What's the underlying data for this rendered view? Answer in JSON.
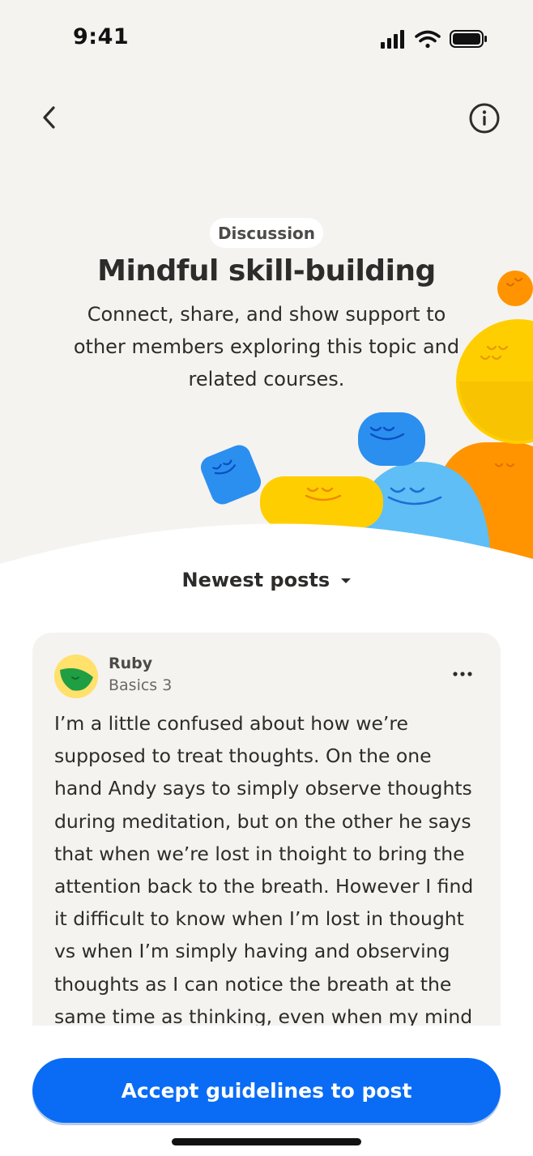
{
  "status_bar": {
    "time": "9:41"
  },
  "header": {
    "badge": "Discussion",
    "title": "Mindful skill-building",
    "subtitle": "Connect, share, and show support to other members exploring this topic and related courses."
  },
  "feed": {
    "sort_label": "Newest posts"
  },
  "post": {
    "author": "Ruby",
    "course": "Basics 3",
    "body": "I’m a little confused about how we’re supposed to treat thoughts. On the one hand Andy says to simply observe thoughts during meditation, but on the other he says that when we’re lost in thoight to bring the attention back to the breath. However I find it difficult to know when I’m lost in thought vs when I’m simply having and observing thoughts as I can notice the breath at the same time as thinking, even when my mind is"
  },
  "cta": {
    "label": "Accept guidelines to post"
  },
  "colors": {
    "accent": "#0a6cf5",
    "hero_bg": "#f5f3f0",
    "yellow": "#ffce00",
    "orange": "#ff9400",
    "blue": "#2b8ff0"
  }
}
